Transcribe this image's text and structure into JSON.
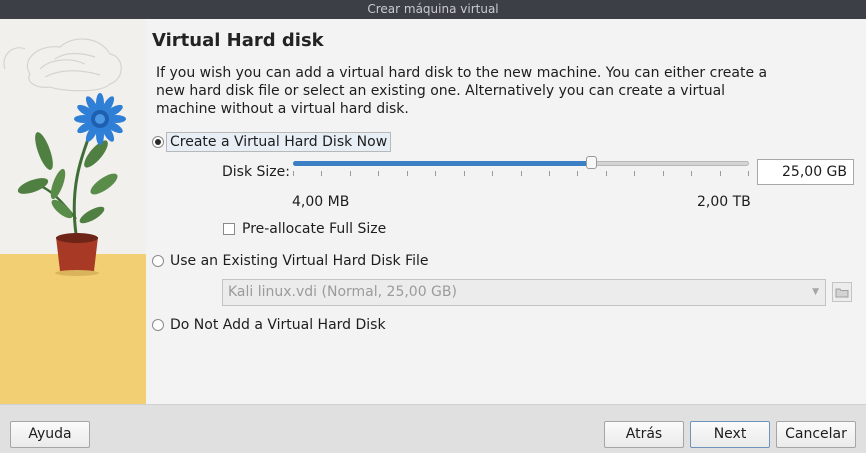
{
  "window": {
    "title": "Crear máquina virtual"
  },
  "page": {
    "title": "Virtual Hard disk",
    "description": "If you wish you can add a virtual hard disk to the new machine. You can either create a new hard disk file or select an existing one. Alternatively you can create a virtual machine without a virtual hard disk."
  },
  "options": {
    "create_now": {
      "label": "Create a Virtual Hard Disk Now",
      "selected": true
    },
    "use_existing": {
      "label": "Use an Existing Virtual Hard Disk File",
      "selected": false
    },
    "no_disk": {
      "label": "Do Not Add a Virtual Hard Disk",
      "selected": false
    }
  },
  "disk_size": {
    "label": "Disk Size:",
    "value": "25,00 GB",
    "slider_fraction": 0.655,
    "min_label": "4,00 MB",
    "max_label": "2,00 TB",
    "tick_count": 17
  },
  "preallocate": {
    "label": "Pre-allocate Full Size",
    "checked": false
  },
  "existing_file": {
    "selected": "Kali linux.vdi (Normal, 25,00 GB)"
  },
  "buttons": {
    "help": "Ayuda",
    "back": "Atrás",
    "next": "Next",
    "cancel": "Cancelar"
  },
  "colors": {
    "accent": "#3b80c4",
    "titlebar": "#3c3f46",
    "flower": "#2f7fd6",
    "sand": "#f2cf73"
  }
}
